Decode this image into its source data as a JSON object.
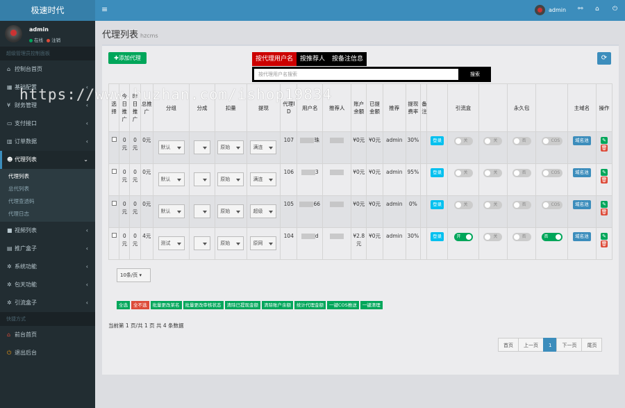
{
  "app": {
    "logo": "极速时代"
  },
  "user": {
    "name": "admin",
    "status_online": "在线",
    "status_logout": "注销"
  },
  "sidebar": {
    "section_main": "超级管理员控制面板",
    "items": [
      {
        "label": "控制台首页",
        "icon": "home-icon"
      },
      {
        "label": "基础配置",
        "icon": "gear-icon"
      },
      {
        "label": "财务管理",
        "icon": "money-icon"
      },
      {
        "label": "支付接口",
        "icon": "card-icon"
      },
      {
        "label": "订单数据",
        "icon": "chart-icon"
      },
      {
        "label": "代理列表",
        "icon": "users-icon"
      },
      {
        "label": "视频列表",
        "icon": "video-icon"
      },
      {
        "label": "推广盒子",
        "icon": "box-icon"
      },
      {
        "label": "系统功能",
        "icon": "cog-icon"
      },
      {
        "label": "包天功能",
        "icon": "cog-icon"
      },
      {
        "label": "引流盒子",
        "icon": "cog-icon"
      }
    ],
    "sub_items": [
      "代理列表",
      "总代列表",
      "代理查透码",
      "代理日志"
    ],
    "section_quick": "快捷方式",
    "quick": [
      {
        "label": "前台首页",
        "icon": "home-icon"
      },
      {
        "label": "退出后台",
        "icon": "power-icon"
      }
    ]
  },
  "topbar": {
    "toggle_icon": "menu-icon",
    "user": "admin",
    "icons": [
      "share-icon",
      "home-icon",
      "power-icon"
    ]
  },
  "page": {
    "title": "代理列表",
    "subtitle": "hzcms"
  },
  "toolbar": {
    "add_label": "添加代理",
    "refresh_icon": "refresh-icon"
  },
  "search": {
    "tabs": [
      "按代理用户名",
      "按推荐人",
      "按备注信息"
    ],
    "placeholder": "按代理用户名搜索",
    "button": "搜索"
  },
  "table": {
    "headers": [
      "选择",
      "今日推广",
      "昨日推广",
      "总推广",
      "分组",
      "分成",
      "扣量",
      "提现",
      "代理ID",
      "用户名",
      "推荐人",
      "账户余额",
      "已提金额",
      "推荐",
      "提现费率",
      "备注",
      "",
      "引流盒",
      "",
      "永久包",
      "",
      "主域名",
      "操作"
    ],
    "rows": [
      {
        "today": "0元",
        "yesterday": "0元",
        "total": "0元",
        "s1": "默认",
        "s3": "原始",
        "s4": "满连",
        "id": "107",
        "name": "珠",
        "balance": "¥0元",
        "withdrawn": "¥0元",
        "referrer": "admin",
        "rate": "30%",
        "login": "登录",
        "t1": "关",
        "t2": "关",
        "t3": "否",
        "t4": "COS",
        "domain": "域名池"
      },
      {
        "today": "0元",
        "yesterday": "0元",
        "total": "0元",
        "s1": "默认",
        "s3": "原始",
        "s4": "满连",
        "id": "106",
        "name": "3",
        "balance": "¥0元",
        "withdrawn": "¥0元",
        "referrer": "admin",
        "rate": "95%",
        "login": "登录",
        "t1": "关",
        "t2": "关",
        "t3": "否",
        "t4": "COS",
        "domain": "域名池"
      },
      {
        "today": "0元",
        "yesterday": "0元",
        "total": "0元",
        "s1": "默认",
        "s3": "原始",
        "s4": "超级",
        "id": "105",
        "name": "66",
        "balance": "¥0元",
        "withdrawn": "¥0元",
        "referrer": "admin",
        "rate": "0%",
        "login": "登录",
        "t1": "关",
        "t2": "关",
        "t3": "否",
        "t4": "COS",
        "domain": "域名池"
      },
      {
        "today": "0元",
        "yesterday": "0元",
        "total": "4元",
        "s1": "测试",
        "s3": "原始",
        "s4": "原网",
        "id": "104",
        "name": "d",
        "balance": "¥2.8元",
        "withdrawn": "¥0元",
        "referrer": "admin",
        "rate": "30%",
        "login": "登录",
        "t1": "开",
        "t2": "关",
        "t3": "否",
        "t4": "否",
        "domain": "域名池"
      }
    ]
  },
  "page_size": "10条/页",
  "bulk_buttons": [
    "全选",
    "全不选",
    "批量更改某名",
    "批量更改审核状态",
    "清除已提现金额",
    "清除账户余额",
    "统计代理金额",
    "一键COS推送",
    "一键清理"
  ],
  "summary": "当前第 1 页/共 1 页 共 4 条数据",
  "pager": [
    "首页",
    "上一页",
    "1",
    "下一页",
    "尾页"
  ],
  "watermark": "https://www.huzhan.com/ishop19834",
  "colors": {
    "topbar": "#3c8dbc",
    "sidebar": "#222d32",
    "success": "#00a65a",
    "danger": "#dd4b39",
    "info": "#00c0ef"
  }
}
